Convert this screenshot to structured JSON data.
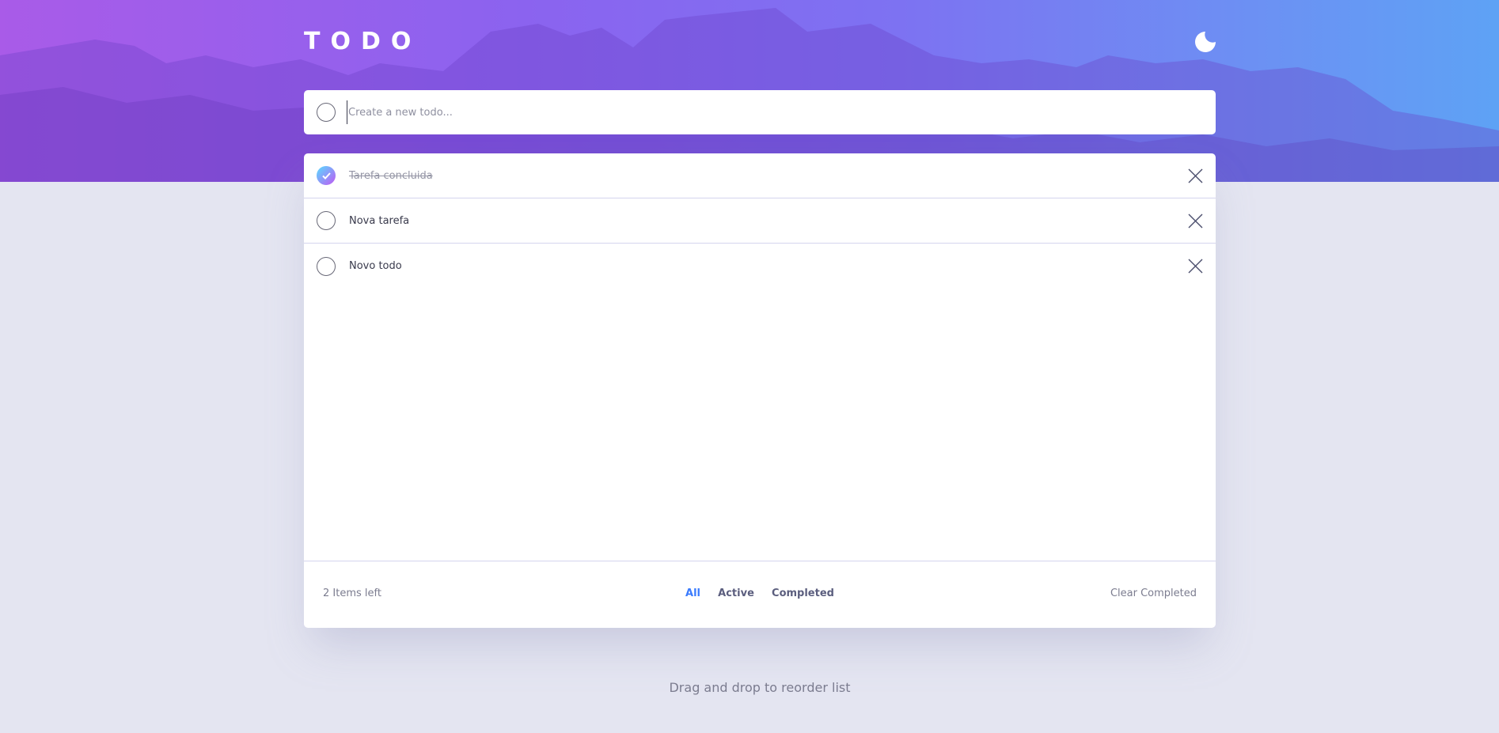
{
  "app": {
    "title": "TODO",
    "theme_icon": "moon-icon"
  },
  "new_todo": {
    "placeholder": "Create a new todo...",
    "value": ""
  },
  "todos": [
    {
      "text": "Tarefa concluida",
      "completed": true
    },
    {
      "text": "Nova tarefa",
      "completed": false
    },
    {
      "text": "Novo todo",
      "completed": false
    }
  ],
  "footer": {
    "items_left": "2 Items left",
    "filters": [
      {
        "label": "All",
        "active": true
      },
      {
        "label": "Active",
        "active": false
      },
      {
        "label": "Completed",
        "active": false
      }
    ],
    "clear_label": "Clear Completed"
  },
  "hint": "Drag and drop to reorder list",
  "colors": {
    "accent": "#3a7bfd",
    "check_gradient_start": "#57ddff",
    "check_gradient_end": "#c058f3",
    "background": "#e4e5f1"
  }
}
